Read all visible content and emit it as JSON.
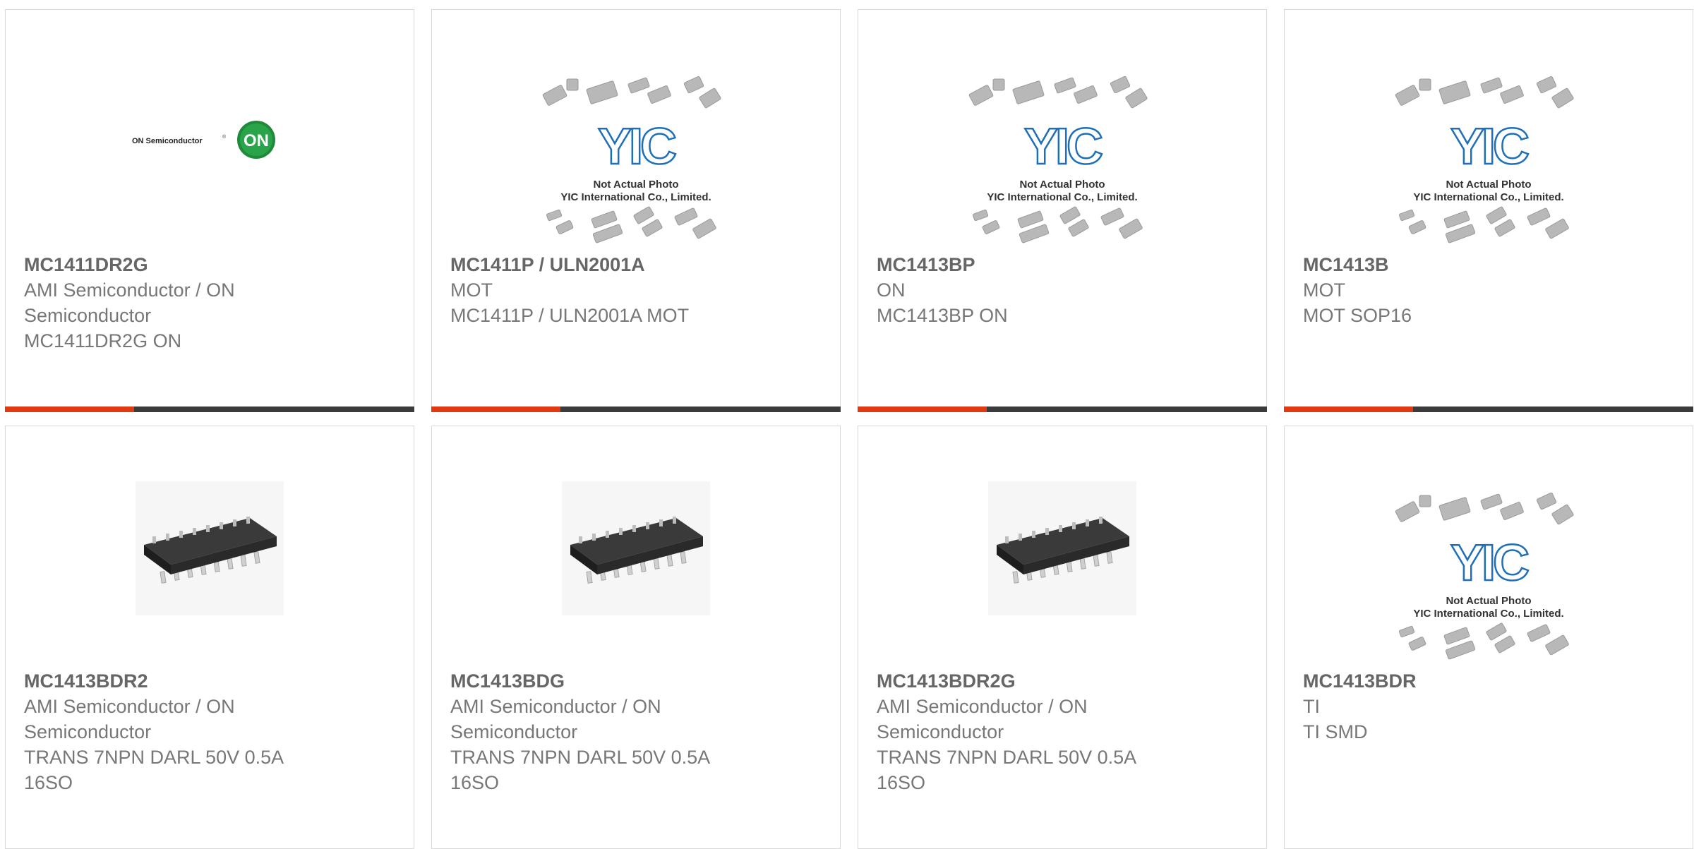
{
  "products": [
    {
      "part": "MC1411DR2G",
      "lines": [
        "AMI Semiconductor / ON",
        "Semiconductor",
        "MC1411DR2G ON"
      ],
      "image": "on-semiconductor-logo"
    },
    {
      "part": "MC1411P / ULN2001A",
      "lines": [
        "MOT",
        "MC1411P / ULN2001A MOT"
      ],
      "image": "not-actual-photo"
    },
    {
      "part": "MC1413BP",
      "lines": [
        "ON",
        "MC1413BP ON"
      ],
      "image": "not-actual-photo"
    },
    {
      "part": "MC1413B",
      "lines": [
        "MOT",
        "MOT SOP16"
      ],
      "image": "not-actual-photo"
    },
    {
      "part": "MC1413BDR2",
      "lines": [
        "AMI Semiconductor / ON",
        "Semiconductor",
        "TRANS 7NPN DARL 50V 0.5A",
        "16SO"
      ],
      "image": "soic16-chip"
    },
    {
      "part": "MC1413BDG",
      "lines": [
        "AMI Semiconductor / ON",
        "Semiconductor",
        "TRANS 7NPN DARL 50V 0.5A",
        "16SO"
      ],
      "image": "soic16-chip"
    },
    {
      "part": "MC1413BDR2G",
      "lines": [
        "AMI Semiconductor / ON",
        "Semiconductor",
        "TRANS 7NPN DARL 50V 0.5A",
        "16SO"
      ],
      "image": "soic16-chip"
    },
    {
      "part": "MC1413BDR",
      "lines": [
        "TI",
        "TI SMD"
      ],
      "image": "not-actual-photo"
    }
  ],
  "placeholder": {
    "line1": "Not Actual Photo",
    "line2": "YIC International Co., Limited.",
    "logo": "YIC"
  },
  "on_logo": {
    "text": "ON Semiconductor",
    "badge": "ON"
  },
  "colors": {
    "accent": "#e03a12",
    "bar": "#3b3b3b",
    "text": "#777777",
    "title": "#666666",
    "onGreen": "#1f8a3a",
    "yicBlue": "#1e6fb8"
  }
}
